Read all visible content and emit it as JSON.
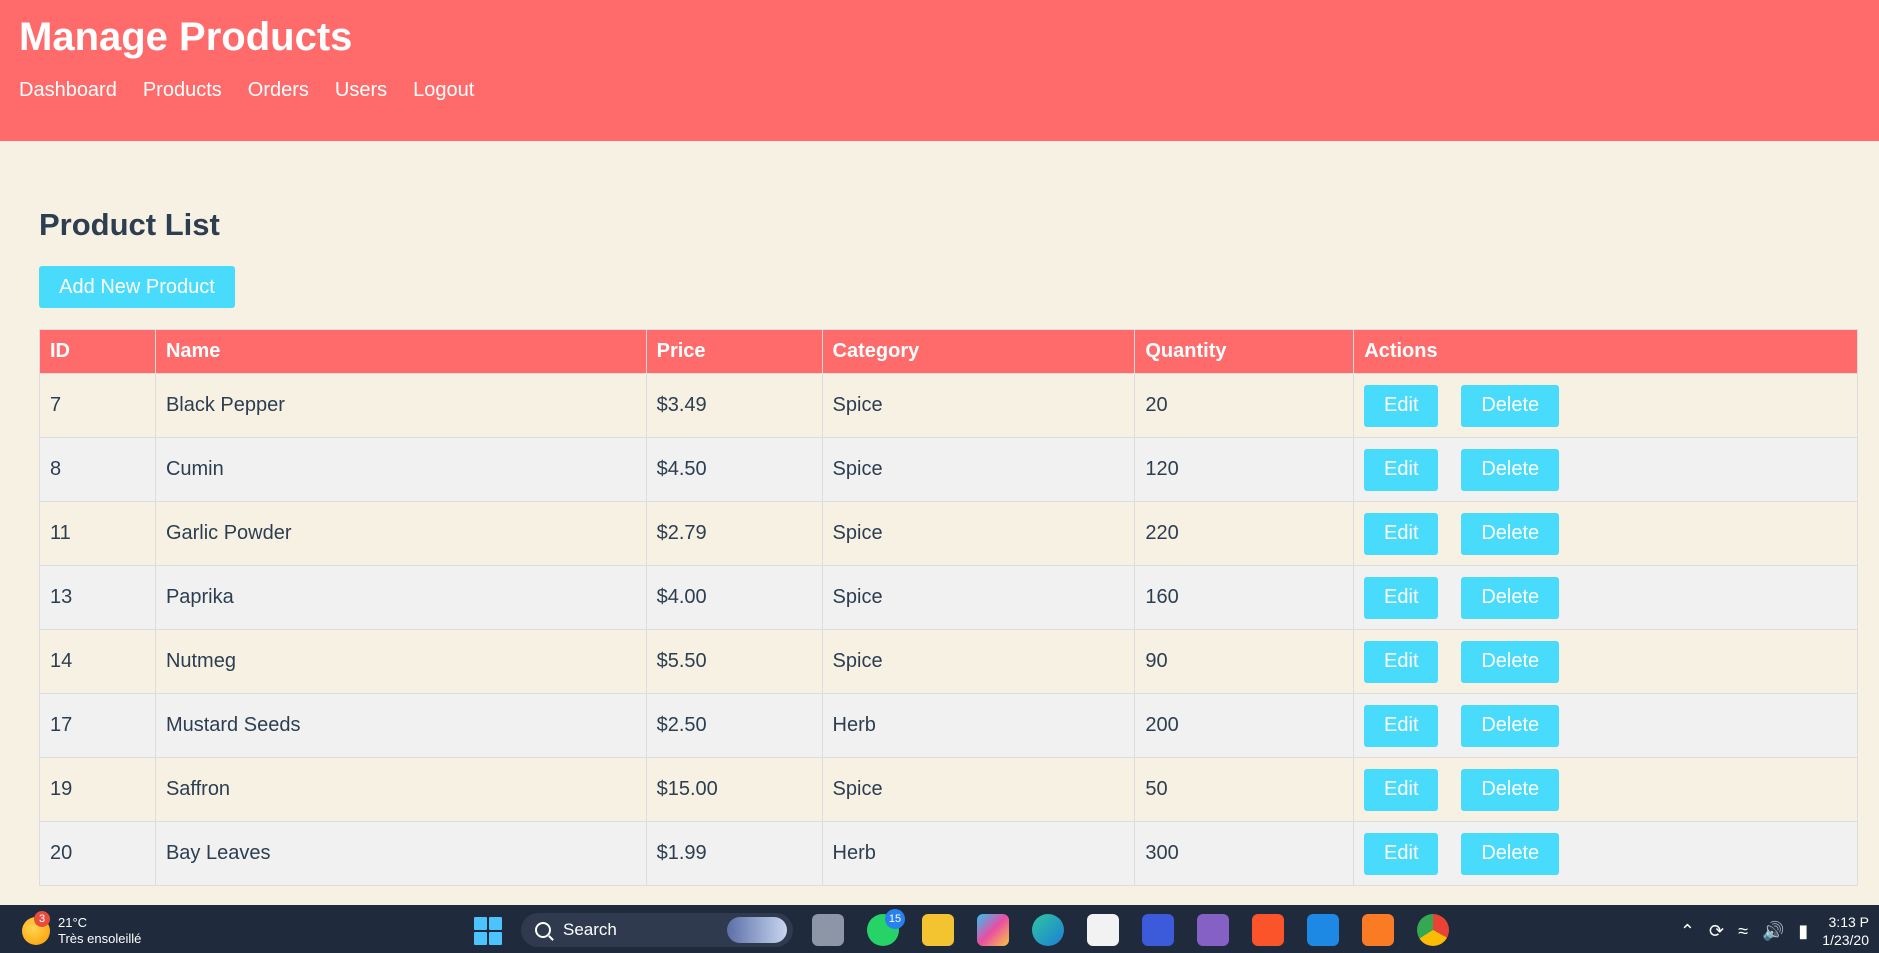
{
  "header": {
    "title": "Manage Products",
    "nav": [
      "Dashboard",
      "Products",
      "Orders",
      "Users",
      "Logout"
    ]
  },
  "main": {
    "page_title": "Product List",
    "add_button": "Add New Product",
    "columns": [
      "ID",
      "Name",
      "Price",
      "Category",
      "Quantity",
      "Actions"
    ],
    "edit_label": "Edit",
    "delete_label": "Delete",
    "rows": [
      {
        "id": "7",
        "name": "Black Pepper",
        "price": "$3.49",
        "category": "Spice",
        "quantity": "20"
      },
      {
        "id": "8",
        "name": "Cumin",
        "price": "$4.50",
        "category": "Spice",
        "quantity": "120"
      },
      {
        "id": "11",
        "name": "Garlic Powder",
        "price": "$2.79",
        "category": "Spice",
        "quantity": "220"
      },
      {
        "id": "13",
        "name": "Paprika",
        "price": "$4.00",
        "category": "Spice",
        "quantity": "160"
      },
      {
        "id": "14",
        "name": "Nutmeg",
        "price": "$5.50",
        "category": "Spice",
        "quantity": "90"
      },
      {
        "id": "17",
        "name": "Mustard Seeds",
        "price": "$2.50",
        "category": "Herb",
        "quantity": "200"
      },
      {
        "id": "19",
        "name": "Saffron",
        "price": "$15.00",
        "category": "Spice",
        "quantity": "50"
      },
      {
        "id": "20",
        "name": "Bay Leaves",
        "price": "$1.99",
        "category": "Herb",
        "quantity": "300"
      }
    ]
  },
  "taskbar": {
    "weather_temp": "21°C",
    "weather_desc": "Très ensoleillé",
    "weather_badge": "3",
    "search_label": "Search",
    "whatsapp_badge": "15",
    "time": "3:13 P",
    "date": "1/23/20",
    "icons": [
      "task-view-icon",
      "whatsapp-icon",
      "file-explorer-icon",
      "copilot-icon",
      "edge-icon",
      "store-icon",
      "app-icon",
      "visual-studio-icon",
      "brave-icon",
      "vscode-icon",
      "xampp-icon",
      "chrome-icon"
    ]
  },
  "colors": {
    "header": "#ff6b6b",
    "background": "#f7f1e3",
    "button": "#48dbfb",
    "text": "#2c3e50"
  }
}
